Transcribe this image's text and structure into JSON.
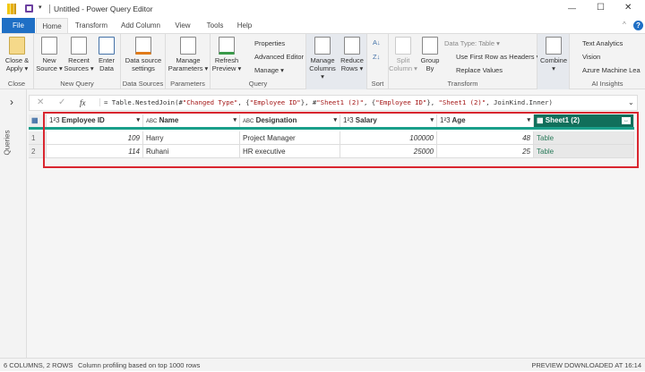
{
  "window": {
    "title": "Untitled - Power Query Editor",
    "controls": {
      "minimize": "—",
      "maximize": "☐",
      "close": "✕"
    }
  },
  "tabs": [
    "File",
    "Home",
    "Transform",
    "Add Column",
    "View",
    "Tools",
    "Help"
  ],
  "ribbon": {
    "close": {
      "button": [
        "Close &",
        "Apply ▾"
      ],
      "label": "Close"
    },
    "new_query": {
      "buttons": [
        [
          "New",
          "Source ▾"
        ],
        [
          "Recent",
          "Sources ▾"
        ],
        [
          "Enter",
          "Data"
        ]
      ],
      "label": "New Query"
    },
    "data_sources": {
      "button": [
        "Data source",
        "settings"
      ],
      "label": "Data Sources"
    },
    "parameters": {
      "button": [
        "Manage",
        "Parameters ▾"
      ],
      "label": "Parameters"
    },
    "query": {
      "button": [
        "Refresh",
        "Preview ▾"
      ],
      "items": [
        "Properties",
        "Advanced Editor",
        "Manage ▾"
      ],
      "label": "Query"
    },
    "manage": {
      "buttons": [
        [
          "Manage",
          "Columns ▾"
        ],
        [
          "Reduce",
          "Rows ▾"
        ]
      ]
    },
    "sort": {
      "label": "Sort"
    },
    "transform": {
      "buttons": [
        [
          "Split",
          "Column ▾"
        ],
        [
          "Group",
          "By"
        ]
      ],
      "items": [
        "Data Type: Table ▾",
        "Use First Row as Headers ▾",
        "Replace Values"
      ],
      "label": "Transform"
    },
    "combine": {
      "button": [
        "Combine",
        "▾"
      ]
    },
    "ai": {
      "items": [
        "Text Analytics",
        "Vision",
        "Azure Machine Lea"
      ],
      "label": "AI Insights"
    }
  },
  "queries_pane": {
    "label": "Queries",
    "toggle": "›"
  },
  "formula": {
    "fx": "fx",
    "parts": [
      "= Table.NestedJoin(#",
      "\"Changed Type\"",
      ", {",
      "\"Employee ID\"",
      "}, #",
      "\"Sheet1 (2)\"",
      ", {",
      "\"Employee ID\"",
      "}, ",
      "\"Sheet1 (2)\"",
      ", JoinKind.Inner)"
    ]
  },
  "grid": {
    "columns": [
      {
        "type": "1²3",
        "name": "Employee ID"
      },
      {
        "type": "ABC",
        "name": "Name"
      },
      {
        "type": "ABC",
        "name": "Designation"
      },
      {
        "type": "1²3",
        "name": "Salary"
      },
      {
        "type": "1²3",
        "name": "Age"
      },
      {
        "type": "table",
        "name": "Sheet1 (2)"
      }
    ],
    "rows": [
      [
        "1",
        "109",
        "Harry",
        "Project Manager",
        "100000",
        "48",
        "Table"
      ],
      [
        "2",
        "114",
        "Ruhani",
        "HR executive",
        "25000",
        "25",
        "Table"
      ]
    ]
  },
  "status": {
    "left": "6 COLUMNS, 2 ROWS",
    "profiling": "Column profiling based on top 1000 rows",
    "right": "PREVIEW DOWNLOADED AT 16:14"
  },
  "colors": {
    "accent": "#1a7f6f",
    "file_tab": "#1f6fc5",
    "highlight_box": "#d9262f",
    "selected_header": "#116f5b"
  }
}
